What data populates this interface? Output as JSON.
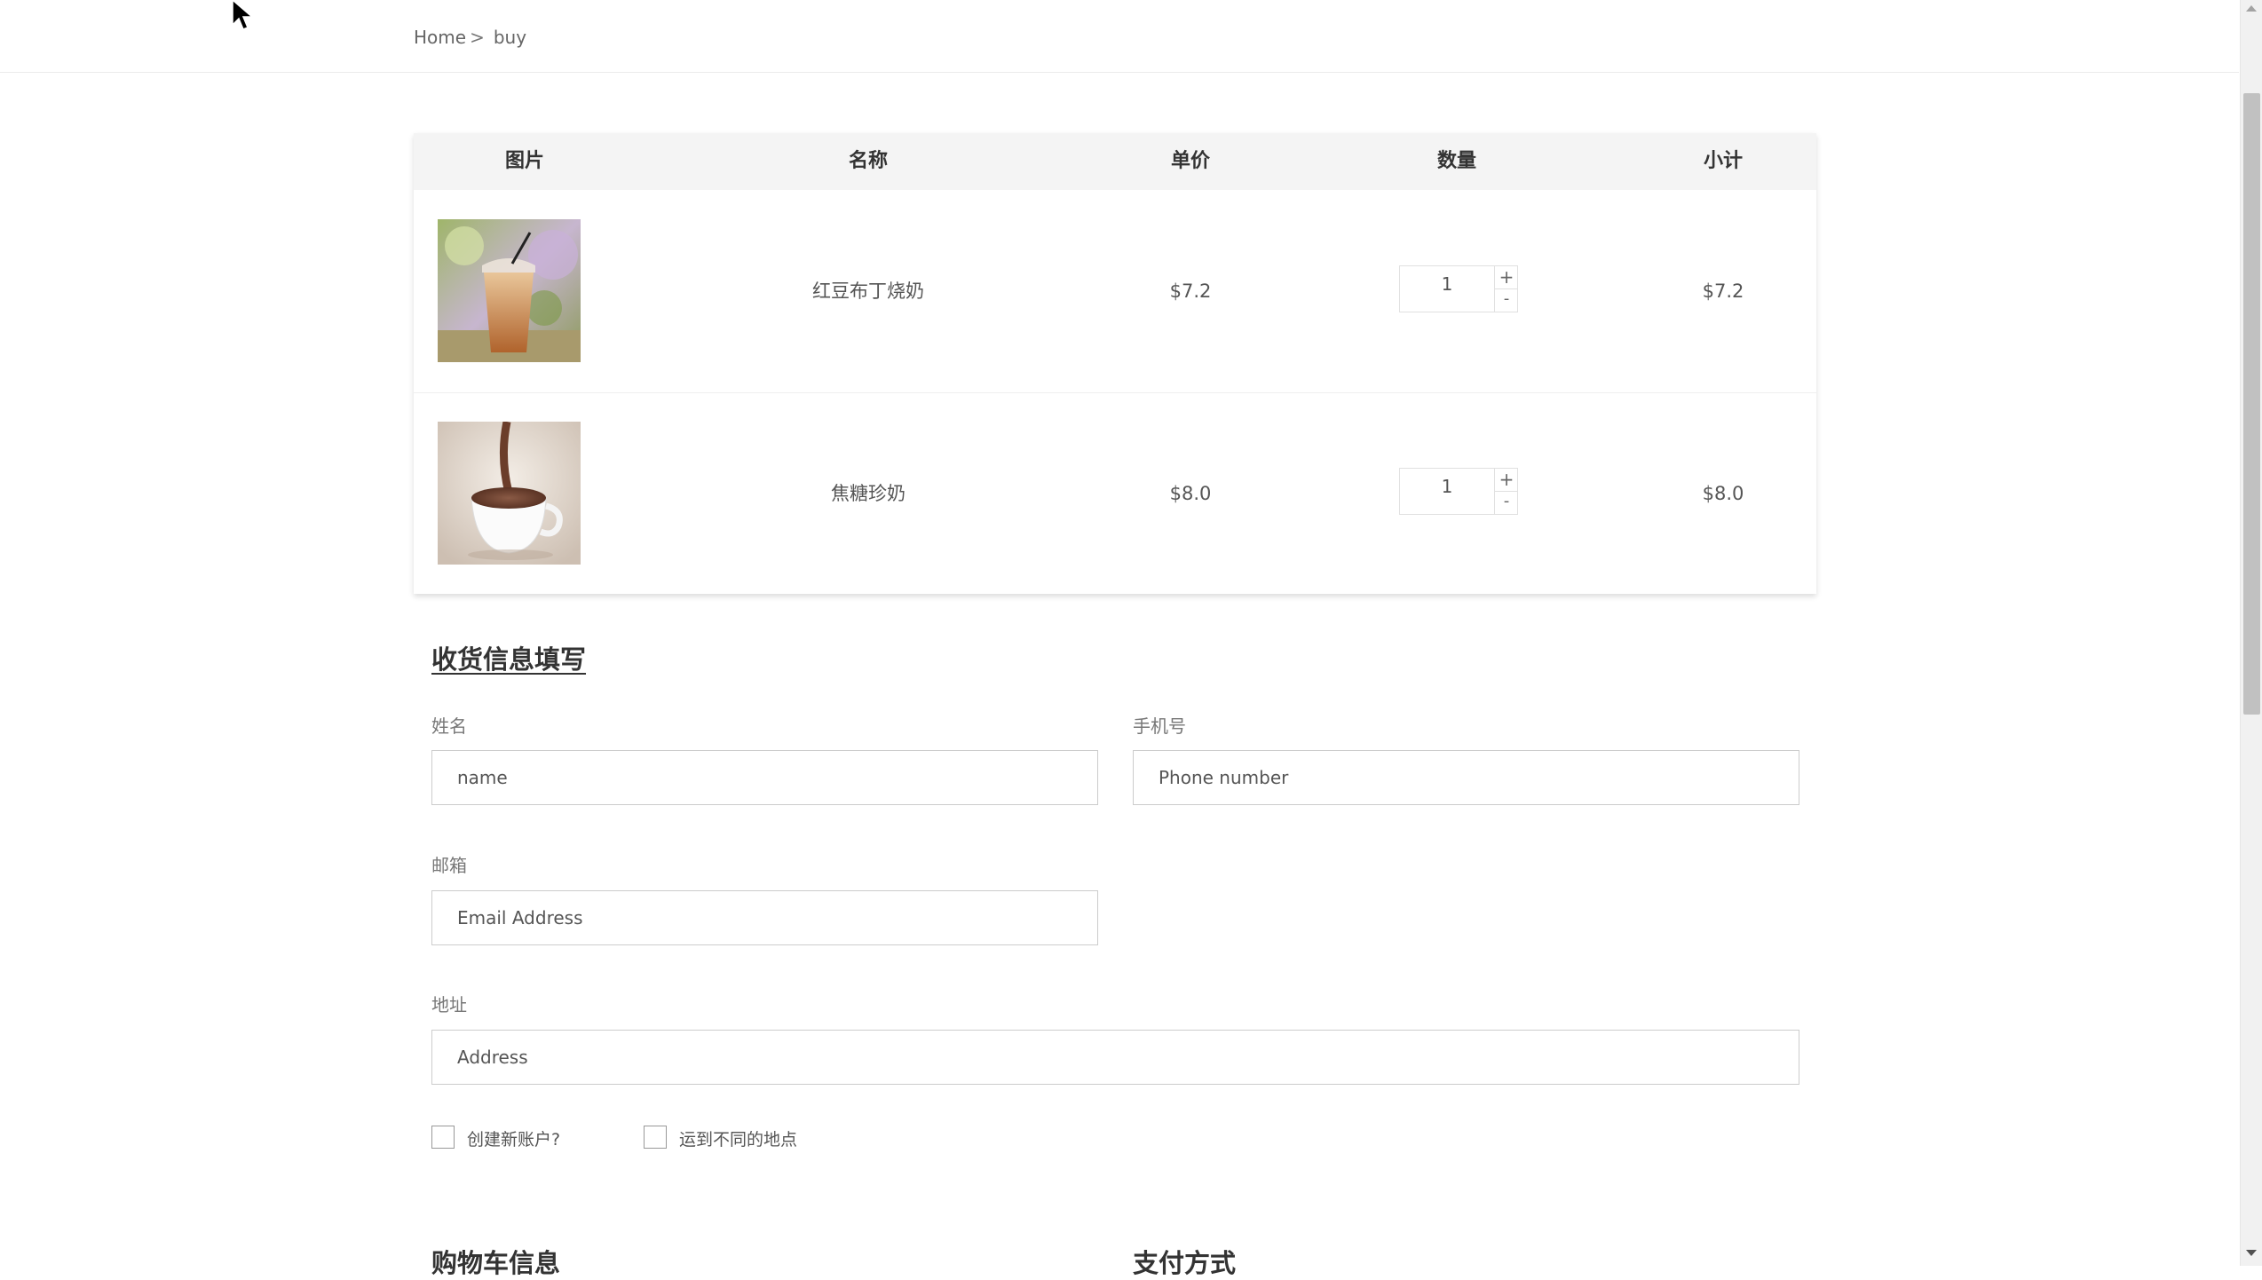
{
  "breadcrumb": {
    "home": "Home",
    "separator": ">",
    "current": "buy"
  },
  "cart": {
    "columns": [
      "图片",
      "名称",
      "单价",
      "数量",
      "小计"
    ],
    "rows": [
      {
        "image_icon": "iced-milk-tea-image",
        "name": "红豆布丁烧奶",
        "price": "$7.2",
        "quantity": "1",
        "subtotal": "$7.2"
      },
      {
        "image_icon": "hot-chocolate-image",
        "name": "焦糖珍奶",
        "price": "$8.0",
        "quantity": "1",
        "subtotal": "$8.0"
      }
    ],
    "qty_plus": "+",
    "qty_minus": "-"
  },
  "form": {
    "title": "收货信息填写",
    "name_label": "姓名",
    "name_placeholder": "name",
    "phone_label": "手机号",
    "phone_placeholder": "Phone number",
    "email_label": "邮箱",
    "email_placeholder": "Email Address",
    "address_label": "地址",
    "address_placeholder": "Address",
    "create_account_label": "创建新账户?",
    "ship_different_label": "运到不同的地点"
  },
  "bottom": {
    "cart_info_title": "购物车信息",
    "payment_title": "支付方式"
  }
}
